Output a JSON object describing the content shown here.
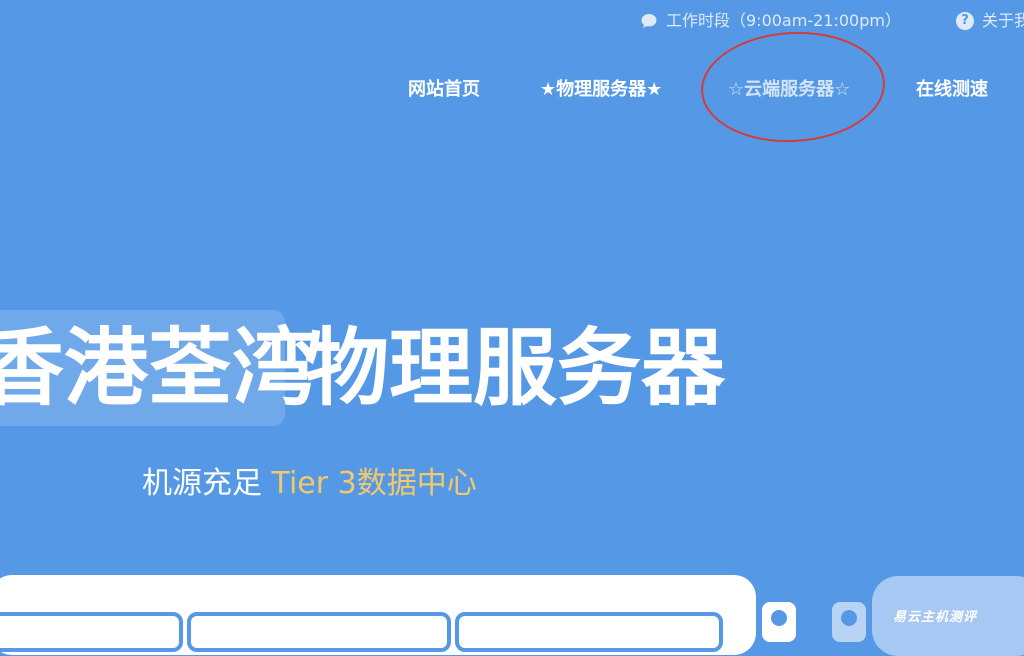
{
  "topbar": {
    "hours_label": "工作时段（9:00am-21:00pm）",
    "about_label": "关于我",
    "hours_icon": "chat-bubble-icon",
    "about_icon": "question-circle-icon"
  },
  "nav": {
    "items": [
      {
        "label": "网站首页"
      },
      {
        "label": "★物理服务器★"
      },
      {
        "label": "☆云端服务器☆"
      },
      {
        "label": "在线测速"
      }
    ]
  },
  "hero": {
    "location": "香港荃湾",
    "title": "物理服务器",
    "subtitle_plain": "机源充足 ",
    "subtitle_highlight": "Tier 3数据中心"
  },
  "watermark": "易云主机测评",
  "colors": {
    "background": "#5599e6",
    "highlight": "#f4c869",
    "annotation": "#d63a3a"
  }
}
